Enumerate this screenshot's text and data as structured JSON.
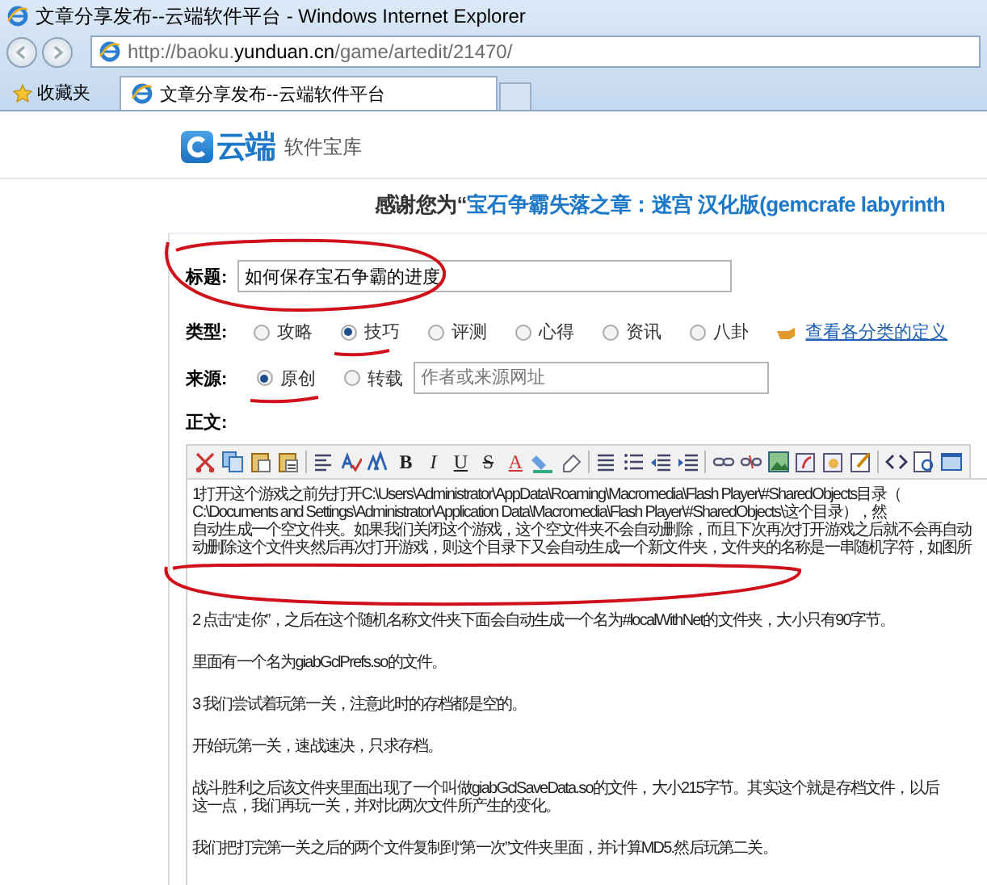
{
  "window": {
    "title": "文章分享发布--云端软件平台 - Windows Internet Explorer"
  },
  "address_bar": {
    "url_prefix": "http://baoku.",
    "url_host": "yunduan.cn",
    "url_path": "/game/artedit/21470/"
  },
  "favorites": {
    "label": "收藏夹"
  },
  "tabs": [
    {
      "label": "文章分享发布--云端软件平台",
      "selected": true
    }
  ],
  "site": {
    "logo_text": "云端",
    "subtitle": "软件宝库"
  },
  "heading": {
    "prefix": "感谢您为“",
    "game": "宝石争霸失落之章：迷宫 汉化版(gemcrafe labyrinth"
  },
  "form": {
    "title_label": "标题:",
    "title_value": "如何保存宝石争霸的进度",
    "type_label": "类型:",
    "type_options": [
      {
        "label": "攻略",
        "selected": false
      },
      {
        "label": "技巧",
        "selected": true
      },
      {
        "label": "评测",
        "selected": false
      },
      {
        "label": "心得",
        "selected": false
      },
      {
        "label": "资讯",
        "selected": false
      },
      {
        "label": "八卦",
        "selected": false
      }
    ],
    "type_help_link": "查看各分类的定义",
    "source_label": "来源:",
    "source_options": [
      {
        "label": "原创",
        "selected": true
      },
      {
        "label": "转载",
        "selected": false
      }
    ],
    "source_placeholder": "作者或来源网址",
    "body_label": "正文:"
  },
  "editor": {
    "toolbar_letters": [
      "B",
      "I",
      "U",
      "S",
      "A"
    ],
    "paragraphs": [
      [
        "1打开这个游戏之前先打开C:\\Users\\Administrator\\AppData\\Roaming\\Macromedia\\Flash Player\\#SharedObjects目录（",
        "C:\\Documents and Settings\\Administrator\\Application Data\\Macromedia\\Flash Player\\#SharedObjects\\这个目录），然",
        "自动生成一个空文件夹。如果我们关闭这个游戏，这个空文件夹不会自动删除，而且下次再次打开游戏之后就不会再自动",
        "动删除这个文件夹然后再次打开游戏，则这个目录下又会自动生成一个新文件夹，文件夹的名称是一串随机字符，如图所"
      ],
      [
        "2 点击“走你”，之后在这个随机名称文件夹下面会自动生成一个名为#localWithNet的文件夹，大小只有90字节。"
      ],
      [
        "里面有一个名为giabGclPrefs.so的文件。"
      ],
      [
        "3 我们尝试着玩第一关，注意此时的存档都是空的。"
      ],
      [
        "开始玩第一关，速战速决，只求存档。"
      ],
      [
        "战斗胜利之后该文件夹里面出现了一个叫做giabGclSaveData.so的文件，大小215字节。其实这个就是存档文件，以后",
        "这一点，我们再玩一关，并对比两次文件所产生的变化。"
      ],
      [
        "我们把打完第一关之后的两个文件复制到“第一次”文件夹里面，并计算MD5.然后玩第二关。"
      ]
    ]
  }
}
